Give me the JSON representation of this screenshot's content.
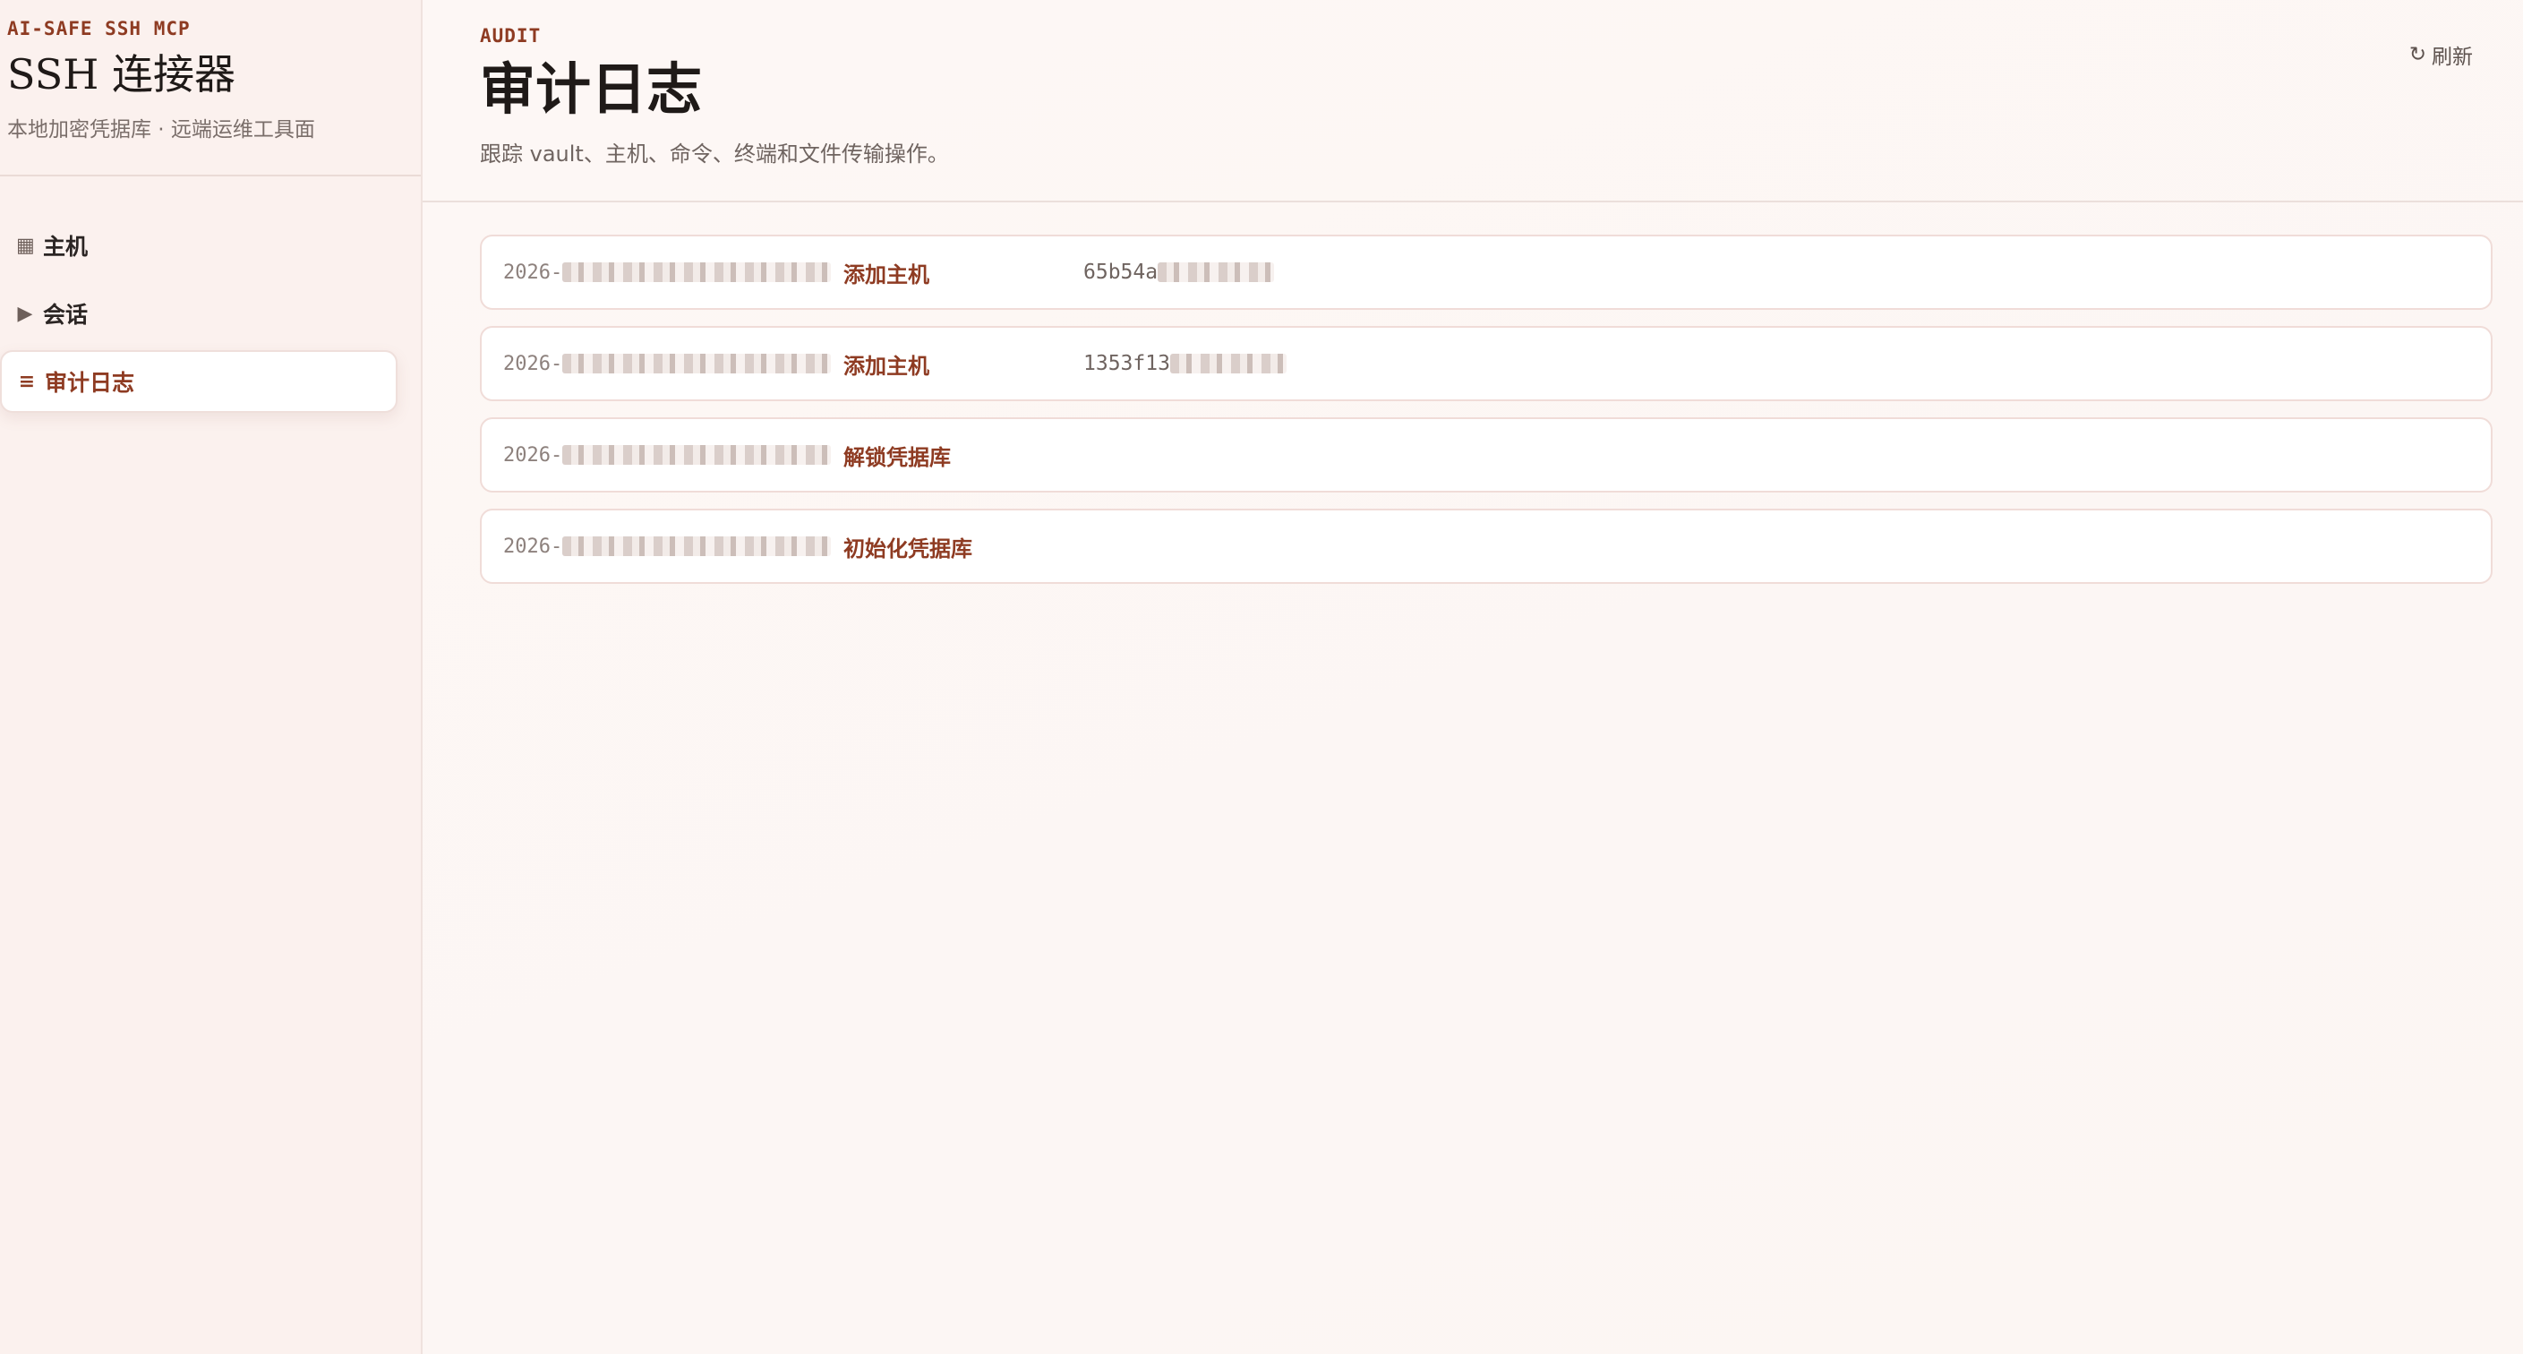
{
  "sidebar": {
    "kicker": "AI-SAFE SSH MCP",
    "title": "SSH 连接器",
    "subtitle": "本地加密凭据库 · 远端运维工具面",
    "items": [
      {
        "icon": "▦",
        "label": "主机",
        "icon_name": "grid-icon"
      },
      {
        "icon": "▶",
        "label": "会话",
        "icon_name": "play-icon"
      },
      {
        "icon": "≡",
        "label": "审计日志",
        "icon_name": "list-icon",
        "active": true
      }
    ]
  },
  "header": {
    "kicker": "AUDIT",
    "title": "审计日志",
    "subtitle": "跟踪 vault、主机、命令、终端和文件传输操作。",
    "refresh_icon": "↻",
    "refresh_label": "刷新"
  },
  "audit": {
    "rows": [
      {
        "time": "2026-",
        "action": "添加主机",
        "target": "65b54a"
      },
      {
        "time": "2026-",
        "action": "添加主机",
        "target": "1353f13"
      },
      {
        "time": "2026-",
        "action": "解锁凭据库",
        "target": ""
      },
      {
        "time": "2026-",
        "action": "初始化凭据库",
        "target": ""
      }
    ]
  },
  "colors": {
    "accent": "#8e3b22",
    "sidebar_bg": "#fbf1ee",
    "page_bg": "#fdf8f6",
    "row_border": "#f0dcd8"
  }
}
